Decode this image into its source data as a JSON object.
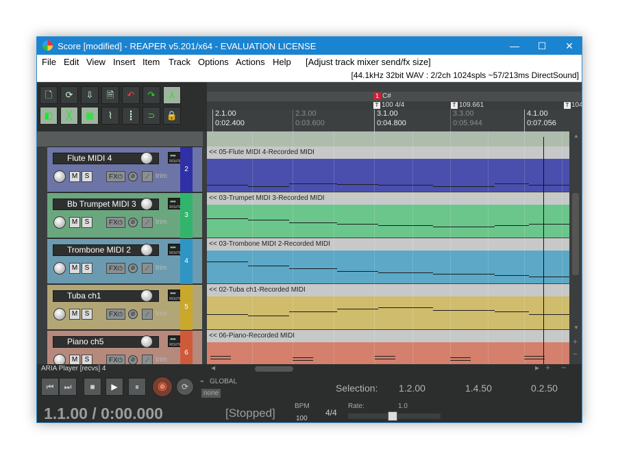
{
  "window": {
    "title": "Score [modified] - REAPER v5.201/x64 - EVALUATION LICENSE",
    "minimize_glyph": "—",
    "maximize_glyph": "☐",
    "close_glyph": "✕"
  },
  "menu": [
    "File",
    "Edit",
    "View",
    "Insert",
    "Item",
    "Track",
    "Options",
    "Actions",
    "Help"
  ],
  "menu_hint": "[Adjust track mixer send/fx size]",
  "audio_info": "[44.1kHz 32bit WAV : 2/2ch 1024spls ~57/213ms DirectSound]",
  "toolbar_icons": [
    "new-project-icon",
    "open-project-icon",
    "save-project-icon",
    "project-settings-icon",
    "undo-icon",
    "redo-icon",
    "metronome-icon",
    "auto-crossfade-icon",
    "ripple-edit-icon",
    "grid-snap-icon",
    "envelope-icon",
    "grid-lines-icon",
    "loop-icon",
    "lock-icon"
  ],
  "tracks": [
    {
      "name": "Flute MIDI 4",
      "number": "2",
      "color": "#2f2fa6",
      "tcp_color": "#6c75a5",
      "lane_color": "#4a4fae",
      "item": "<< 05-Flute MIDI 4-Recorded MIDI"
    },
    {
      "name": "Bb Trumpet MIDI 3",
      "number": "3",
      "color": "#31b56d",
      "tcp_color": "#6aa77f",
      "lane_color": "#6bc68b",
      "item": "<< 03-Trumpet MIDI 3-Recorded MIDI"
    },
    {
      "name": "Trombone MIDI 2",
      "number": "4",
      "color": "#2e95c5",
      "tcp_color": "#6b9bb1",
      "lane_color": "#5ca8c6",
      "item": "<< 03-Trombone MIDI 2-Recorded MIDI"
    },
    {
      "name": "Tuba ch1",
      "number": "5",
      "color": "#c9a82c",
      "tcp_color": "#b2a676",
      "lane_color": "#cfbc6d",
      "item": "<< 02-Tuba ch1-Recorded MIDI"
    },
    {
      "name": "Piano ch5",
      "number": "6",
      "color": "#cf5a3a",
      "tcp_color": "#b6897d",
      "lane_color": "#d4806c",
      "item": "<< 06-Piano-Recorded MIDI"
    }
  ],
  "track_controls": {
    "mute": "M",
    "solo": "S",
    "fx": "FX",
    "trim": "trim",
    "route": "ROUTE"
  },
  "ruler": {
    "marker_number": "1",
    "marker_name": "C#",
    "tempo_markers": [
      "100 4/4",
      "109.661",
      "104"
    ],
    "tempo_marker_glyph": "T",
    "bars": [
      {
        "beat": "2.1.00",
        "time": "0:02.400",
        "dim": false
      },
      {
        "beat": "2.3.00",
        "time": "0:03.600",
        "dim": true
      },
      {
        "beat": "3.1.00",
        "time": "0:04.800",
        "dim": false
      },
      {
        "beat": "3.3.00",
        "time": "0:05.944",
        "dim": true
      },
      {
        "beat": "4.1.00",
        "time": "0:07.056",
        "dim": false
      }
    ]
  },
  "selected_track_label": "ARIA Player [recvs] 4",
  "transport": {
    "position": "1.1.00 / 0:00.000",
    "status": "[Stopped]",
    "bpm_label": "BPM",
    "bpm": "100",
    "time_sig": "4/4",
    "rate_label": "Rate:",
    "rate": "1.0",
    "selection_label": "Selection:",
    "selection_start": "1.2.00",
    "selection_end": "1.4.50",
    "selection_length": "0.2.50",
    "global_label": "GLOBAL",
    "global_value": "none"
  },
  "colors": {
    "titlebar": "#1b84d1",
    "accent_record": "#c0553c"
  }
}
